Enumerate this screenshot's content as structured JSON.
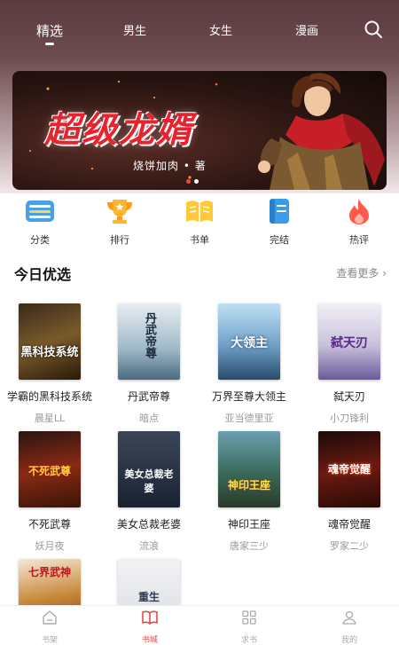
{
  "top_nav": {
    "tabs": [
      {
        "label": "精选",
        "active": true
      },
      {
        "label": "男生",
        "active": false
      },
      {
        "label": "女生",
        "active": false
      },
      {
        "label": "漫画",
        "active": false
      }
    ],
    "search_icon": "search-icon"
  },
  "banner": {
    "title": "超级龙婿",
    "author_line": "烧饼加肉 • 著",
    "page_count": 2,
    "active_page": 1
  },
  "categories": [
    {
      "label": "分类",
      "icon": "category-icon"
    },
    {
      "label": "排行",
      "icon": "trophy-icon"
    },
    {
      "label": "书单",
      "icon": "book-list-icon"
    },
    {
      "label": "完结",
      "icon": "finished-icon"
    },
    {
      "label": "热评",
      "icon": "flame-icon"
    }
  ],
  "section": {
    "title": "今日优选",
    "more_label": "查看更多 ›"
  },
  "books": [
    {
      "name": "学霸的黑科技系统",
      "author": "晨星LL",
      "cover_text": "黑科技系统"
    },
    {
      "name": "丹武帝尊",
      "author": "暗点",
      "cover_text": "丹武帝尊"
    },
    {
      "name": "万界至尊大领主",
      "author": "亚当德里亚",
      "cover_text": "大领主"
    },
    {
      "name": "弑天刃",
      "author": "小刀锋利",
      "cover_text": "弑天刃"
    },
    {
      "name": "不死武尊",
      "author": "妖月夜",
      "cover_text": "不死武尊"
    },
    {
      "name": "美女总裁老婆",
      "author": "流浪",
      "cover_text": "美女总裁老婆"
    },
    {
      "name": "神印王座",
      "author": "唐家三少",
      "cover_text": "神印王座"
    },
    {
      "name": "魂帝觉醒",
      "author": "罗家二少",
      "cover_text": "魂帝觉醒"
    },
    {
      "name": "",
      "author": "",
      "cover_text": "七界武神"
    },
    {
      "name": "",
      "author": "",
      "cover_text": "重生"
    }
  ],
  "bottom_nav": [
    {
      "label": "书架",
      "icon": "home-icon",
      "active": false
    },
    {
      "label": "书城",
      "icon": "book-open-icon",
      "active": true
    },
    {
      "label": "求书",
      "icon": "grid-icon",
      "active": false
    },
    {
      "label": "我的",
      "icon": "user-icon",
      "active": false
    }
  ],
  "colors": {
    "accent": "#e54848",
    "banner_title": "#e8232d",
    "muted": "#999999"
  }
}
